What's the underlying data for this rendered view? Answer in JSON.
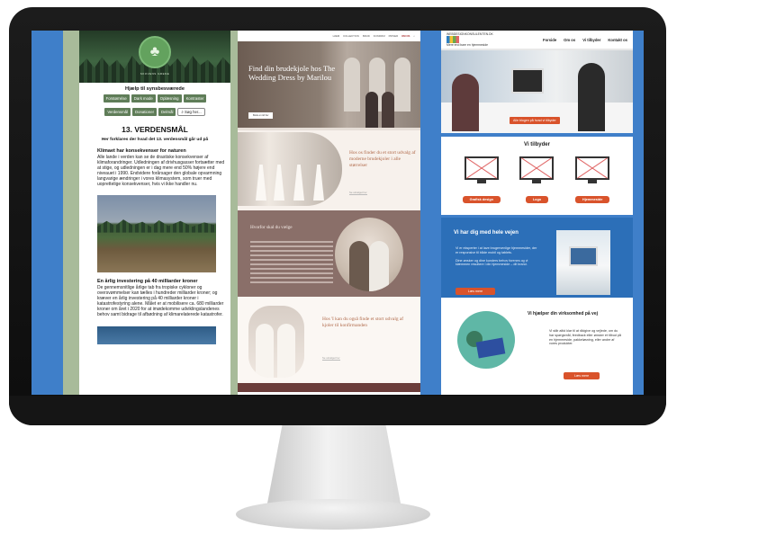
{
  "panel1": {
    "logo_text": "SKOVENS GRENE",
    "help_title": "Hjælp til synsbesværede",
    "buttons_row1": [
      "Forstørrelse",
      "Dark mode",
      "Oplæsning",
      "Kontraster"
    ],
    "buttons_row2": [
      "Verdensmål",
      "Donationer",
      "Delmål"
    ],
    "search_label": "Søg her...",
    "page_title": "13. VERDENSMÅL",
    "subtitle": "Her forklares der hvad det 13. verdensmål går ud på",
    "section1_heading": "Klimaet har konsekvenser for naturen",
    "section1_text": "Alle lande i verden kan se de drastiske konsekvenser af klimaforandringer. Udledningen af drivhusgasser fortsætter med at stige, og udledningen er i dag mere end 50% højere end niveauet i 1990. Endvidere forårsager den globale opvarmning langvarige ændringer i vores klimasystem, som truer med uoprettelige konsekvenser, hvis vi ikke handler nu.",
    "section2_heading": "En årlig investering på 40 milliarder kroner",
    "section2_text": "De gennemsnitlige årlige tab fra tropiske cykloner og oversvømmelser kan tælles i hundreder milliarder kroner; og kræver en årlig investering på 40 milliarder kroner i katastrofestyring alene. Målet er at mobilisere ca. 680 milliarder kroner om året i 2020 for at imødekomme udviklingslandenes behov samt bidrage til afbødning af klimarelaterede katastrofer."
  },
  "panel2": {
    "nav": [
      "HJEM",
      "KOLLEKTION",
      "BRUD",
      "KONFIRM",
      "PRISER",
      "OM OS"
    ],
    "hero_title": "Find din brudekjole hos The Wedding Dress by Marilou",
    "hero_button": "Book en tid her",
    "s1_text": "Hos os finder du et stort udvalg af moderne brudekjoler i alle størrelser",
    "s1_link": "Se udvalget her",
    "s2_title": "Hvorfor skal du vælge",
    "s3_text": "Hos 'I kan du også finde et stort udvalg af kjoler til konfirmanden",
    "s3_link": "Se udvalget her"
  },
  "panel3": {
    "logo_text": "WEBDESIGNKONSULENTEN.DK",
    "logo_sub": "Mere end bare en hjemmeside",
    "menu": [
      "Forside",
      "Om os",
      "Vi tilbyder",
      "Kontakt os"
    ],
    "hero_button": "Alle blogen på hvad vi tilbyder",
    "offer_title": "Vi tilbyder",
    "offers": [
      "Grafisk design",
      "Logo",
      "Hjemmeside"
    ],
    "blue_title": "Vi har dig med hele vejen",
    "blue_text1": "Vi er eksperter i at lave brugervenlige hjemmesider, der er responsive til både mobil og tablets.",
    "blue_text2": "Dine ønsker og dine kunders behov forenes og vi klæmmen resultere i din hjemmeside – dit brand.",
    "blue_button": "Læs mere",
    "grow_title": "Vi hjælper din virksomhed på vej",
    "grow_text": "Vi står altid klar til at rådgive og vejlede, om du har spørgsmål, feedback eller ønsker et tilbud på en hjemmeside, pakkeløsning, eller andre af vores produkter.",
    "grow_button": "Læs mere"
  },
  "colors": {
    "screen_bg": "#3f7fc9",
    "accent_orange": "#d9532b",
    "green_button": "#5f7d58",
    "bridal_brown": "#8a6f69"
  }
}
